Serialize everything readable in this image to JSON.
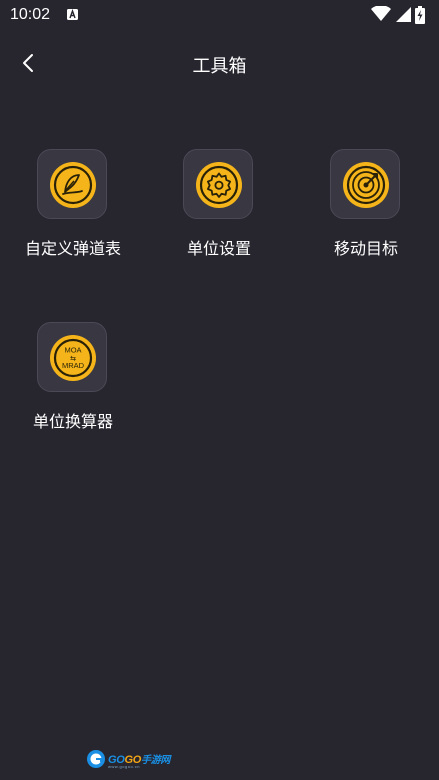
{
  "status_bar": {
    "time": "10:02",
    "icons": [
      "notification-a-icon",
      "wifi-icon",
      "signal-icon",
      "battery-charging-icon"
    ]
  },
  "header": {
    "title": "工具箱",
    "back_icon": "chevron-left-icon"
  },
  "tools": [
    {
      "label": "自定义弹道表",
      "icon": "feather-quill-icon"
    },
    {
      "label": "单位设置",
      "icon": "gear-icon"
    },
    {
      "label": "移动目标",
      "icon": "target-arrow-icon"
    },
    {
      "label": "单位换算器",
      "icon": "moa-mrad-converter-icon"
    }
  ],
  "converter_icon_text": {
    "top": "MOA",
    "middle": "⇆",
    "bottom": "MRAD"
  },
  "watermark": {
    "part1": "GO",
    "part2": "GO",
    "part3": "手游网",
    "sub": "www.gogoo.cn"
  },
  "colors": {
    "background": "#27262f",
    "tile": "#393842",
    "tile_border": "#4a4955",
    "accent": "#f5b51a",
    "icon_ring": "#2a2208",
    "text": "#ffffff"
  }
}
